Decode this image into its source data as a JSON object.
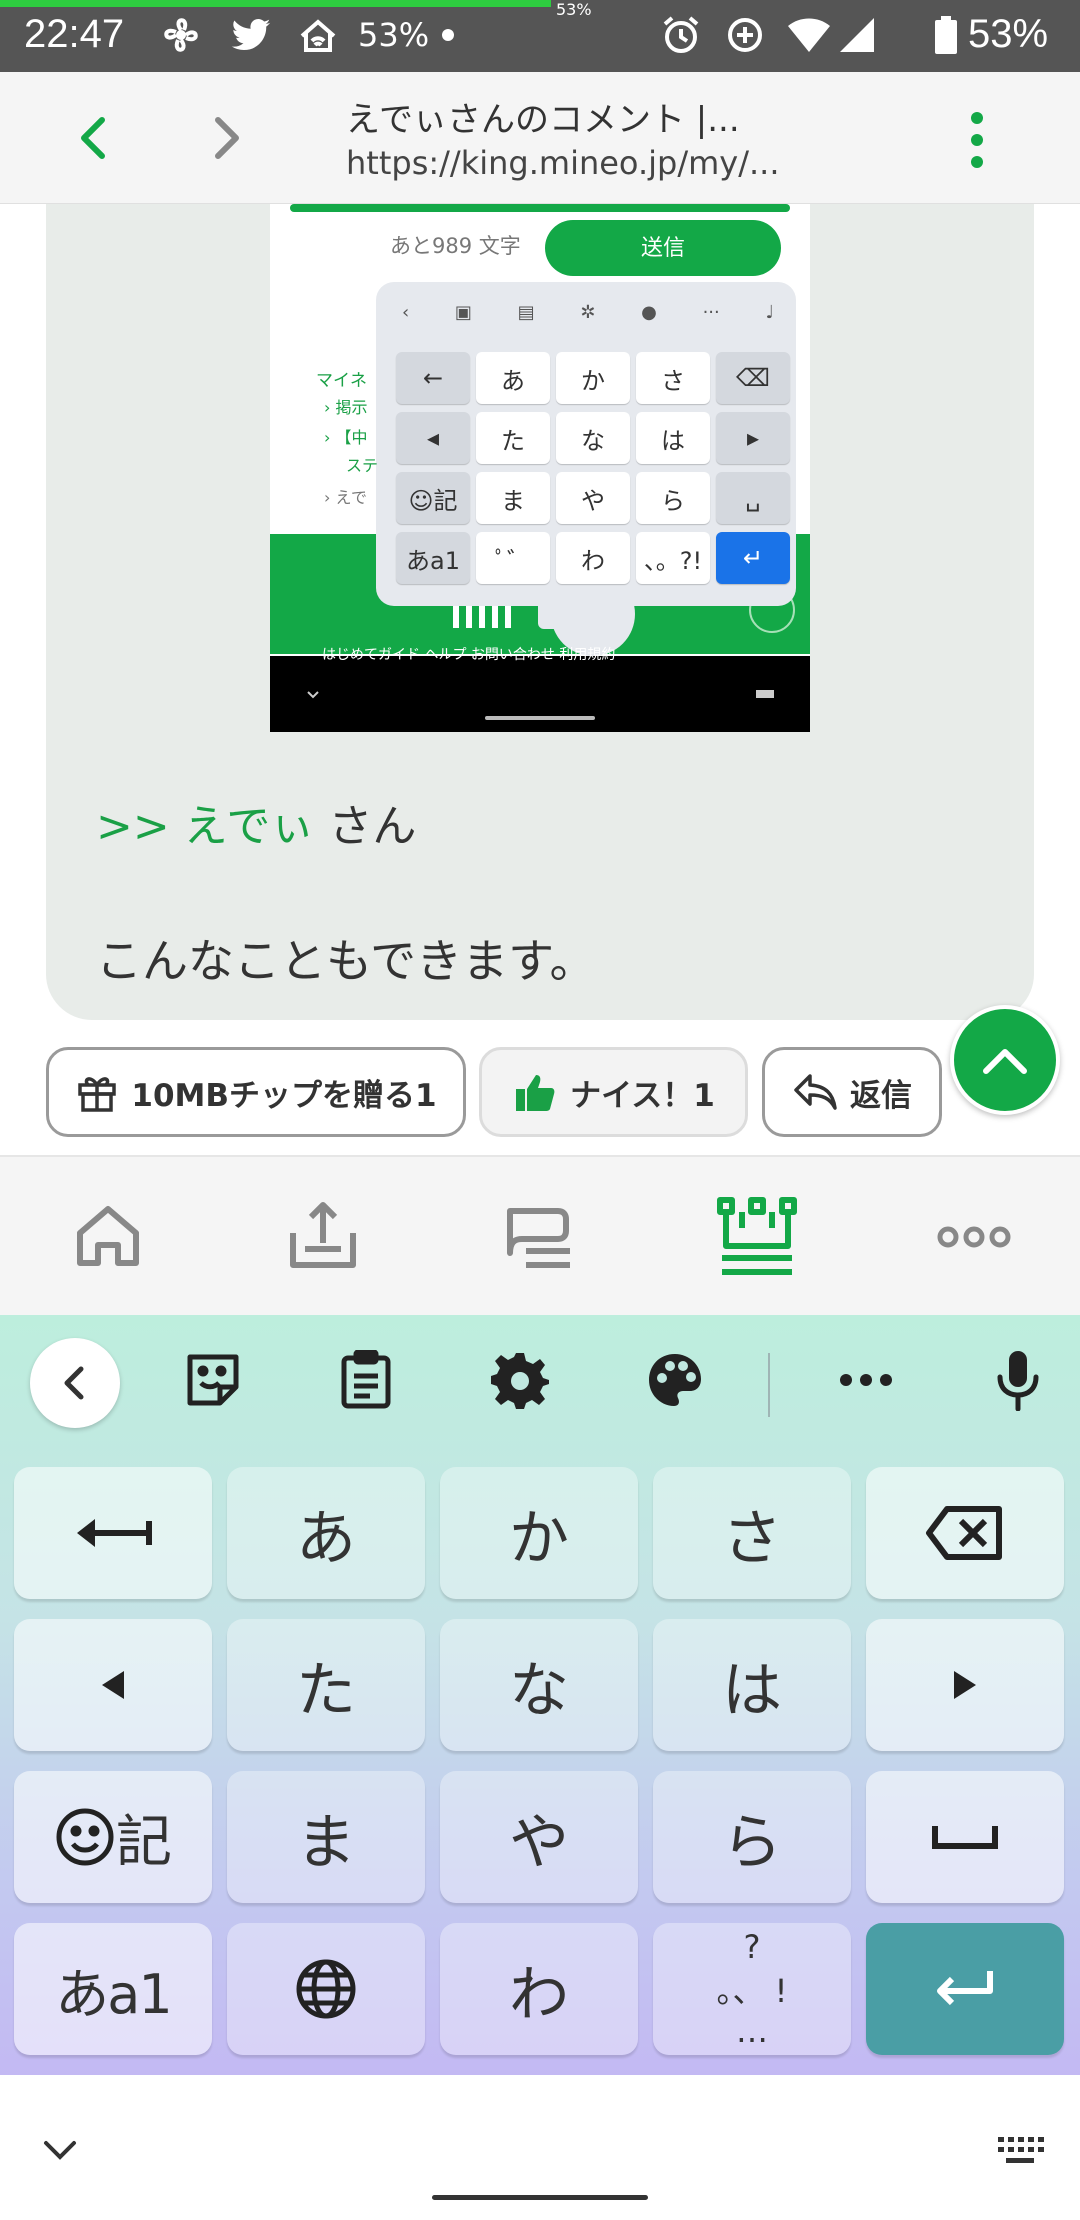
{
  "status_bar": {
    "time": "22:47",
    "left_percent": "53%",
    "load_percent": "53%",
    "load_progress": 0.51,
    "battery": "53%",
    "icons": [
      "fan-icon",
      "twitter-icon",
      "home-wifi-icon",
      "dot-icon",
      "alarm-icon",
      "data-saver-icon",
      "wifi-icon",
      "signal-icon",
      "battery-icon"
    ]
  },
  "toolbar": {
    "title": "えでぃさんのコメント |...",
    "url": "https://king.mineo.jp/my/..."
  },
  "embedded_screenshot": {
    "remaining_chars": "あと989 文字",
    "send_label": "送信",
    "side_text": [
      "マイネ",
      "› 掲示",
      "› 【中",
      "ステ",
      "› えで"
    ],
    "footer_text": "はじめてガイド ヘルプ お問い合わせ 利用規約",
    "keys": [
      [
        "←",
        "あ",
        "か",
        "さ",
        "⌫"
      ],
      [
        "◂",
        "た",
        "な",
        "は",
        "▸"
      ],
      [
        "☺記",
        "ま",
        "や",
        "ら",
        "␣"
      ],
      [
        "あa1",
        "ﾟ゛",
        "わ",
        "、。?!",
        "↵"
      ]
    ]
  },
  "comment": {
    "reply_mention": ">> えでぃ",
    "reply_suffix": "さん",
    "text": "こんなこともできます。"
  },
  "actions": {
    "chip_label": "10MBチップを贈る1",
    "nice_label": "ナイス！1",
    "reply_label": "返信"
  },
  "bottom_nav": [
    "home-icon",
    "upload-icon",
    "chat-icon",
    "crown-icon",
    "more-icon"
  ],
  "keyboard": {
    "toolbar_icons": [
      "chevron-left-icon",
      "sticker-icon",
      "clipboard-icon",
      "gear-icon",
      "palette-icon",
      "ellipsis-icon",
      "mic-icon"
    ],
    "rows": [
      [
        "",
        "あ",
        "か",
        "さ",
        ""
      ],
      [
        "",
        "た",
        "な",
        "は",
        ""
      ],
      [
        "記",
        "ま",
        "や",
        "ら",
        ""
      ],
      [
        "あa1",
        "",
        "わ",
        "",
        ""
      ]
    ],
    "punct_key": {
      "top": "?",
      "middle": "。、 !",
      "bottom": "…"
    }
  },
  "colors": {
    "accent": "#13a847",
    "mention": "#1aa046",
    "enter_key": "#4a9ea5"
  }
}
